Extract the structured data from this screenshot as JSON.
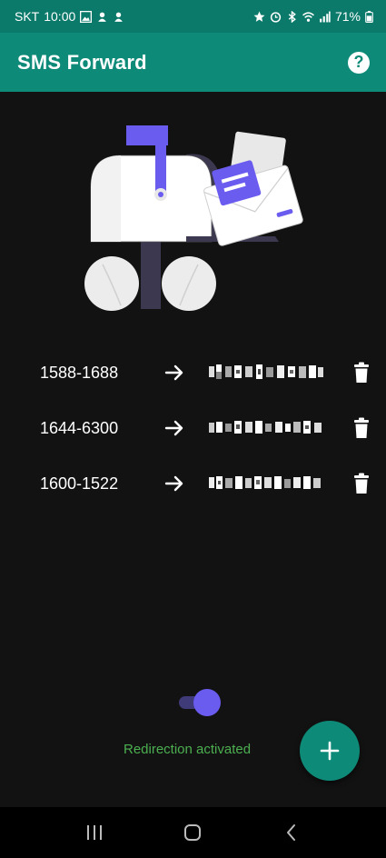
{
  "status_bar": {
    "carrier": "SKT",
    "time": "10:00",
    "battery": "71%",
    "left_icons": [
      "gallery-icon",
      "notification-icon",
      "notification-icon"
    ],
    "right_icons": [
      "star-icon",
      "alarm-icon",
      "bluetooth-icon",
      "wifi-icon",
      "signal-icon",
      "battery-icon"
    ]
  },
  "app_bar": {
    "title": "SMS Forward",
    "help_icon": "help-icon"
  },
  "rules": [
    {
      "source": "1588-1688",
      "target_redacted": true
    },
    {
      "source": "1644-6300",
      "target_redacted": true
    },
    {
      "source": "1600-1522",
      "target_redacted": true
    }
  ],
  "toggle": {
    "checked": true
  },
  "redirection_status": "Redirection activated",
  "fab": {
    "icon": "plus-icon"
  },
  "colors": {
    "status_bar": "#0c7a6b",
    "app_bar": "#0e8a78",
    "background": "#121212",
    "accent": "#6b5cf0",
    "status_text": "#4caf50"
  },
  "nav": [
    "recents-icon",
    "home-icon",
    "back-icon"
  ]
}
